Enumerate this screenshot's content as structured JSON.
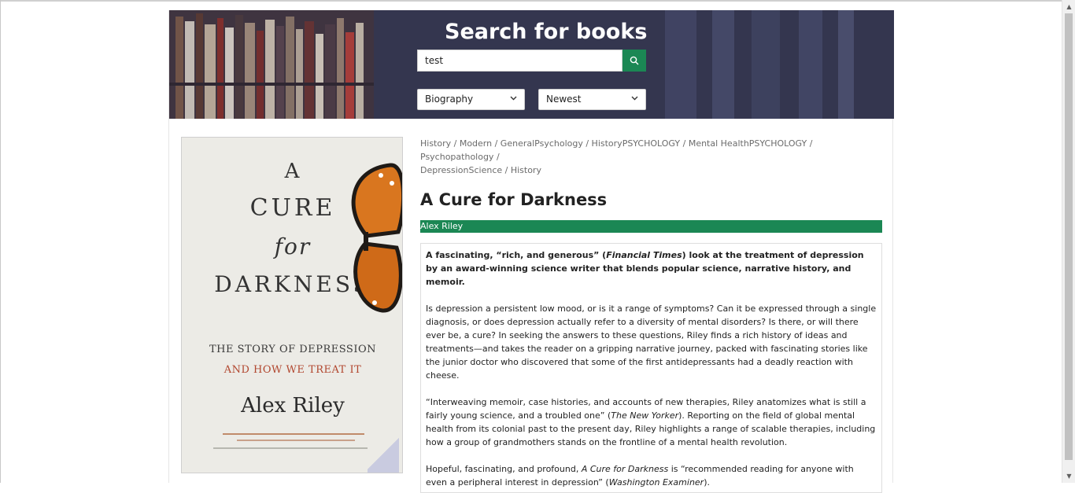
{
  "hero": {
    "title": "Search for books",
    "search_value": "test",
    "search_icon": "search-icon",
    "genre_selected": "Biography",
    "sort_selected": "Newest"
  },
  "cover": {
    "line_a": "A",
    "line_cure": "CURE",
    "line_for": "for",
    "line_darkness": "DARKNESS",
    "subtitle_1": "THE STORY OF DEPRESSION",
    "subtitle_2": "AND HOW WE TREAT IT",
    "author": "Alex Riley"
  },
  "book": {
    "breadcrumbs_line1": "History / Modern / GeneralPsychology / HistoryPSYCHOLOGY / Mental HealthPSYCHOLOGY / Psychopathology /",
    "breadcrumbs_line2": "DepressionScience / History",
    "title": "A Cure for Darkness",
    "author": "Alex Riley",
    "desc_p1_a": "A fascinating, “rich, and generous” (",
    "desc_p1_em": "Financial Times",
    "desc_p1_b": ") look at the treatment of depression by an award-winning science writer that blends popular science, narrative history, and memoir.",
    "desc_p2": "Is depression a persistent low mood, or is it a range of symptoms? Can it be expressed through a single diagnosis, or does depression actually refer to a diversity of mental disorders? Is there, or will there ever be, a cure? In seeking the answers to these questions, Riley finds a rich history of ideas and treatments—and takes the reader on a gripping narrative journey, packed with fascinating stories like the junior doctor who discovered that some of the first antidepressants had a deadly reaction with cheese.",
    "desc_p3_a": "“Interweaving memoir, case histories, and accounts of new therapies, Riley anatomizes what is still a fairly young science, and a troubled one” (",
    "desc_p3_em": "The New Yorker",
    "desc_p3_b": "). Reporting on the field of global mental health from its colonial past to the present day, Riley highlights a range of scalable therapies, including how a group of grandmothers stands on the frontline of a mental health revolution.",
    "desc_p4_a": "Hopeful, fascinating, and profound, ",
    "desc_p4_em": "A Cure for Darkness",
    "desc_p4_b": " is “recommended reading for anyone with even a peripheral interest in depression” (",
    "desc_p4_em2": "Washington Examiner",
    "desc_p4_c": ")."
  },
  "colors": {
    "accent_green": "#1b8754",
    "hero_bg": "#35395a"
  }
}
